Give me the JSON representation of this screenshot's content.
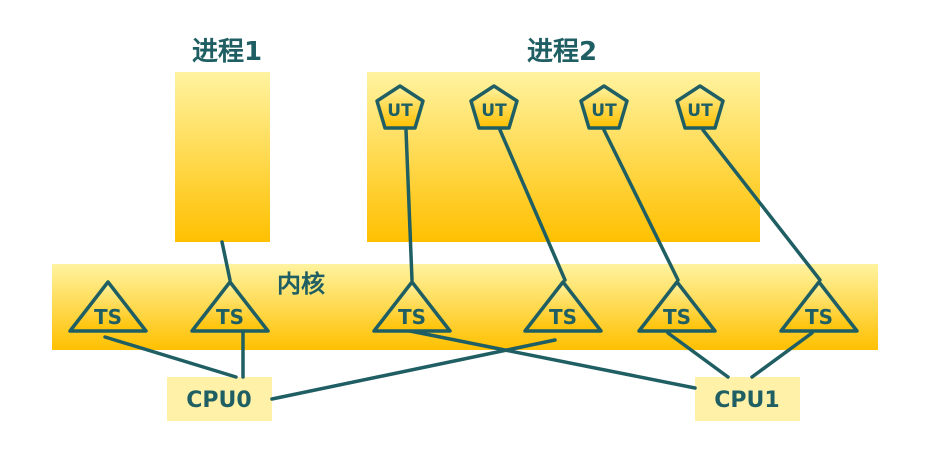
{
  "colors": {
    "ink": "#1f5f63",
    "box_top": "#fff3a0",
    "box_bottom": "#ffc000",
    "cpu_fill": "#fff2a8"
  },
  "process1": {
    "title": "进程1"
  },
  "process2": {
    "title": "进程2",
    "threads": [
      "UT",
      "UT",
      "UT",
      "UT"
    ]
  },
  "kernel": {
    "title": "内核",
    "threads": [
      "TS",
      "TS",
      "TS",
      "TS",
      "TS",
      "TS"
    ]
  },
  "cpus": [
    {
      "label": "CPU0"
    },
    {
      "label": "CPU1"
    }
  ]
}
